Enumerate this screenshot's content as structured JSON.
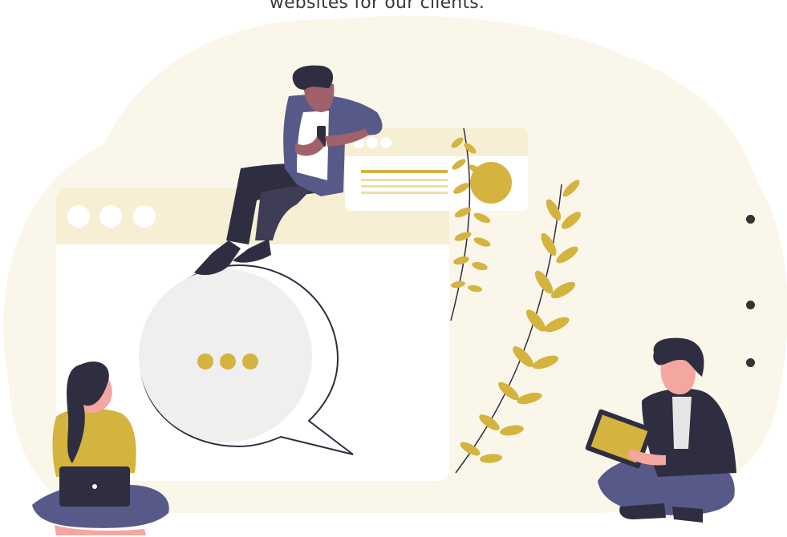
{
  "section": {
    "intro_text": "websites for our clients."
  },
  "bullets": [
    {
      "text": ""
    },
    {
      "text": ""
    },
    {
      "text": ""
    }
  ],
  "colors": {
    "accent_gold": "#d4b33f",
    "light_cream": "#faf6ea",
    "cream_bar": "#f6efd4",
    "dark_navy": "#2f2e41",
    "skin_tone": "#f3a7a0",
    "text_dark": "#3a3a3a"
  },
  "illustration": {
    "icon": "website-collaboration-illustration"
  }
}
